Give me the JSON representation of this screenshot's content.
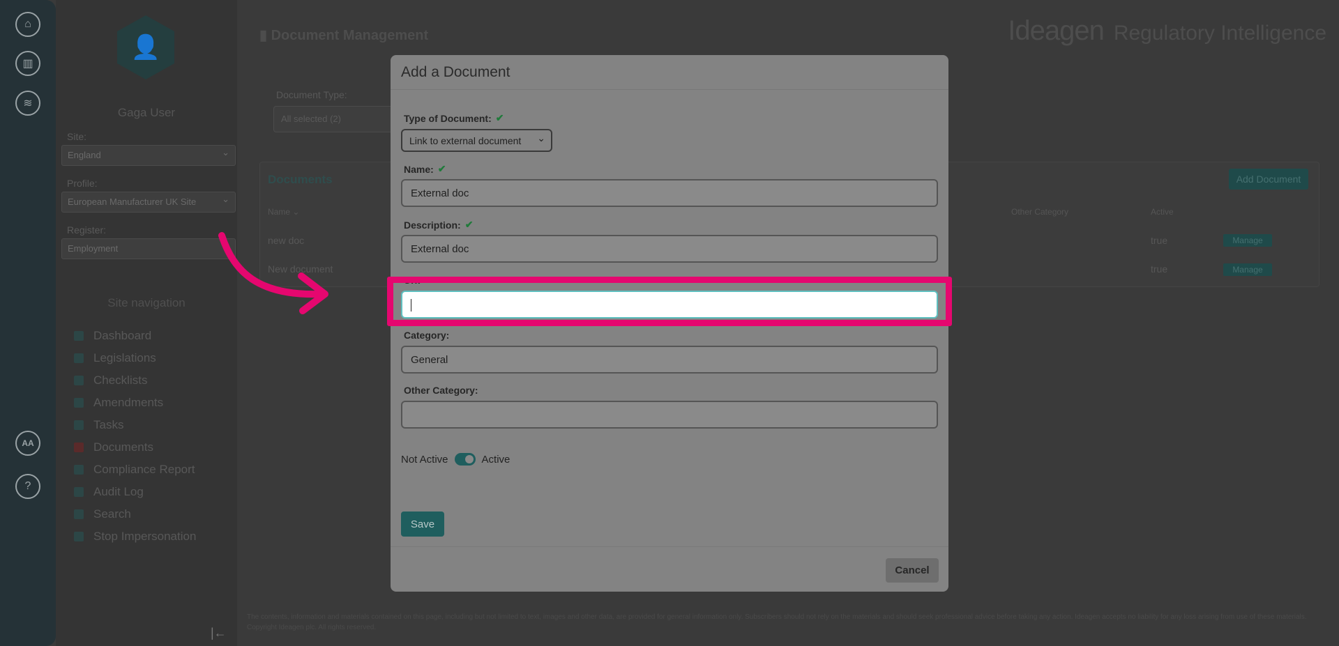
{
  "rail": {
    "icons": [
      "home-icon",
      "building-icon",
      "settings-sliders-icon",
      "user-initials-icon",
      "help-icon"
    ],
    "initials": "AA",
    "help": "?"
  },
  "sidebar": {
    "user_name": "Gaga User",
    "site_label": "Site:",
    "site_value": "England",
    "profile_label": "Profile:",
    "profile_value": "European Manufacturer UK Site",
    "register_label": "Register:",
    "register_value": "Employment",
    "nav_heading": "Site navigation",
    "nav_items": [
      {
        "label": "Dashboard",
        "icon": "dashboard-icon"
      },
      {
        "label": "Legislations",
        "icon": "gavel-icon"
      },
      {
        "label": "Checklists",
        "icon": "checklist-icon"
      },
      {
        "label": "Amendments",
        "icon": "amendment-icon"
      },
      {
        "label": "Tasks",
        "icon": "tasks-icon"
      },
      {
        "label": "Documents",
        "icon": "document-icon"
      },
      {
        "label": "Compliance Report",
        "icon": "report-icon"
      },
      {
        "label": "Audit Log",
        "icon": "audit-icon"
      },
      {
        "label": "Search",
        "icon": "search-icon"
      },
      {
        "label": "Stop Impersonation",
        "icon": "stop-icon"
      }
    ],
    "collapse_glyph": "|←"
  },
  "page": {
    "title": "Document Management",
    "brand_name": "Ideagen",
    "brand_product": "Regulatory Intelligence",
    "doc_type_label": "Document Type:",
    "doc_type_value": "All selected (2)",
    "documents_heading": "Documents",
    "add_document": "Add Document",
    "columns": {
      "name": "Name ⌄",
      "other_category": "Other Category",
      "active": "Active"
    },
    "rows": [
      {
        "name": "new doc",
        "active": "true",
        "action": "Manage"
      },
      {
        "name": "New document",
        "active": "true",
        "action": "Manage"
      }
    ],
    "footer": "The contents, information and materials contained on this page, including but not limited to text, images and other data, are provided for general information only. Subscribers should not rely on the materials and should seek professional advice before taking any action. Ideagen accepts no liability for any loss arising from use of these materials. Copyright Ideagen plc. All rights reserved."
  },
  "modal": {
    "title": "Add a Document",
    "type_label": "Type of Document:",
    "type_value": "Link to external document",
    "name_label": "Name:",
    "name_value": "External doc",
    "description_label": "Description:",
    "description_value": "External doc",
    "url_label": "Url:",
    "url_value": "",
    "category_label": "Category:",
    "category_value": "General",
    "other_category_label": "Other Category:",
    "other_category_value": "",
    "toggle_off_label": "Not Active",
    "toggle_on_label": "Active",
    "toggle_state": "on",
    "save": "Save",
    "cancel": "Cancel",
    "check_glyph": "✔"
  },
  "colors": {
    "highlight": "#e5076f",
    "accent": "#1f5e5e",
    "focus_border": "#5fc0c0"
  }
}
